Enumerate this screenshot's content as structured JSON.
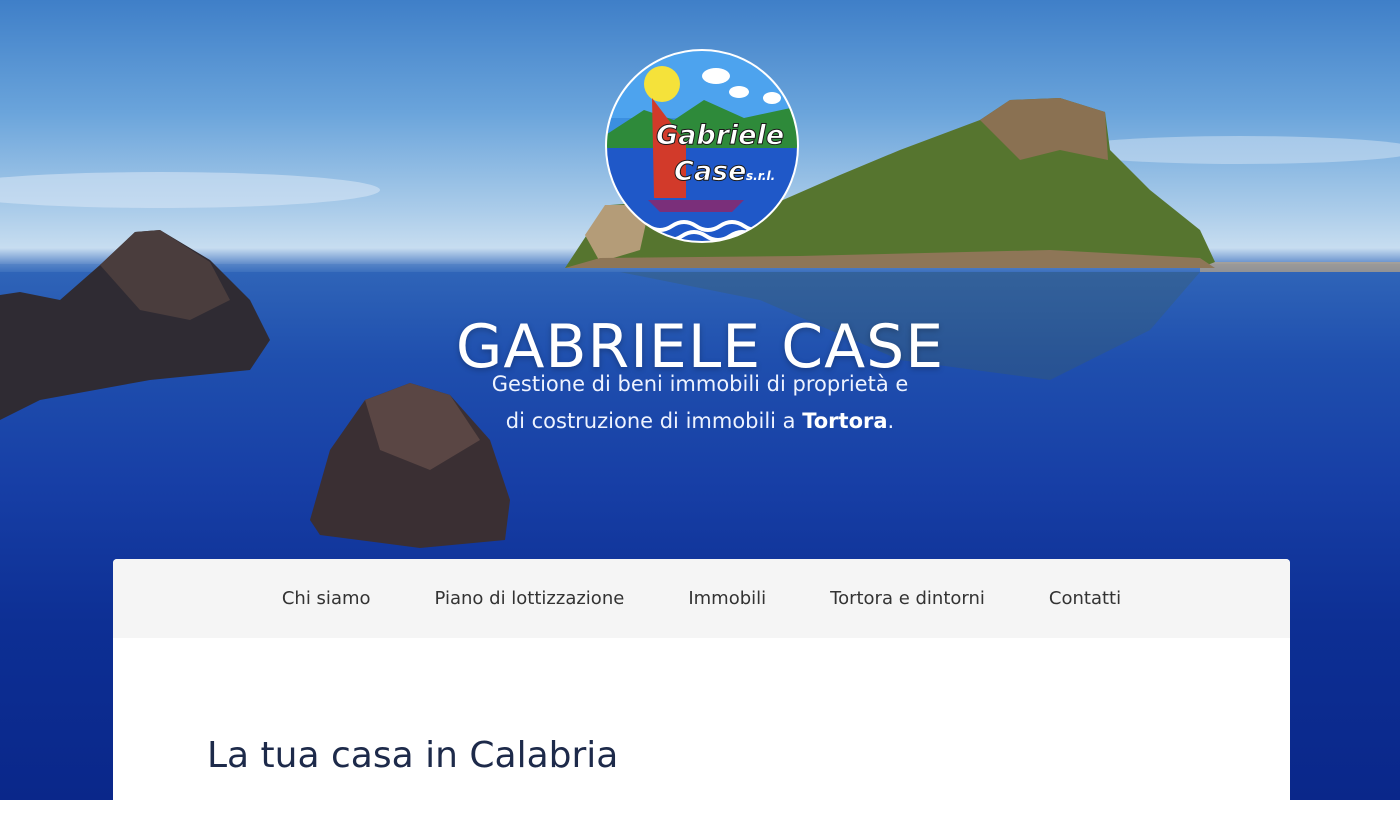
{
  "hero": {
    "logo": {
      "line1": "Gabriele",
      "line2": "Case",
      "suffix": "s.r.l."
    },
    "title": "GABRIELE CASE",
    "tagline_line1": "Gestione di beni immobili di proprietà e",
    "tagline_line2_prefix": "di costruzione di immobili a ",
    "tagline_highlight": "Tortora",
    "tagline_suffix": "."
  },
  "nav": {
    "items": [
      {
        "label": "Chi siamo"
      },
      {
        "label": "Piano di lottizzazione"
      },
      {
        "label": "Immobili"
      },
      {
        "label": "Tortora e dintorni"
      },
      {
        "label": "Contatti"
      }
    ]
  },
  "main": {
    "heading": "La tua casa in Calabria"
  },
  "colors": {
    "sea": "#173fa6",
    "sky": "#6aa4db",
    "heading": "#1d2a4a",
    "nav_bg": "#f5f5f5"
  }
}
